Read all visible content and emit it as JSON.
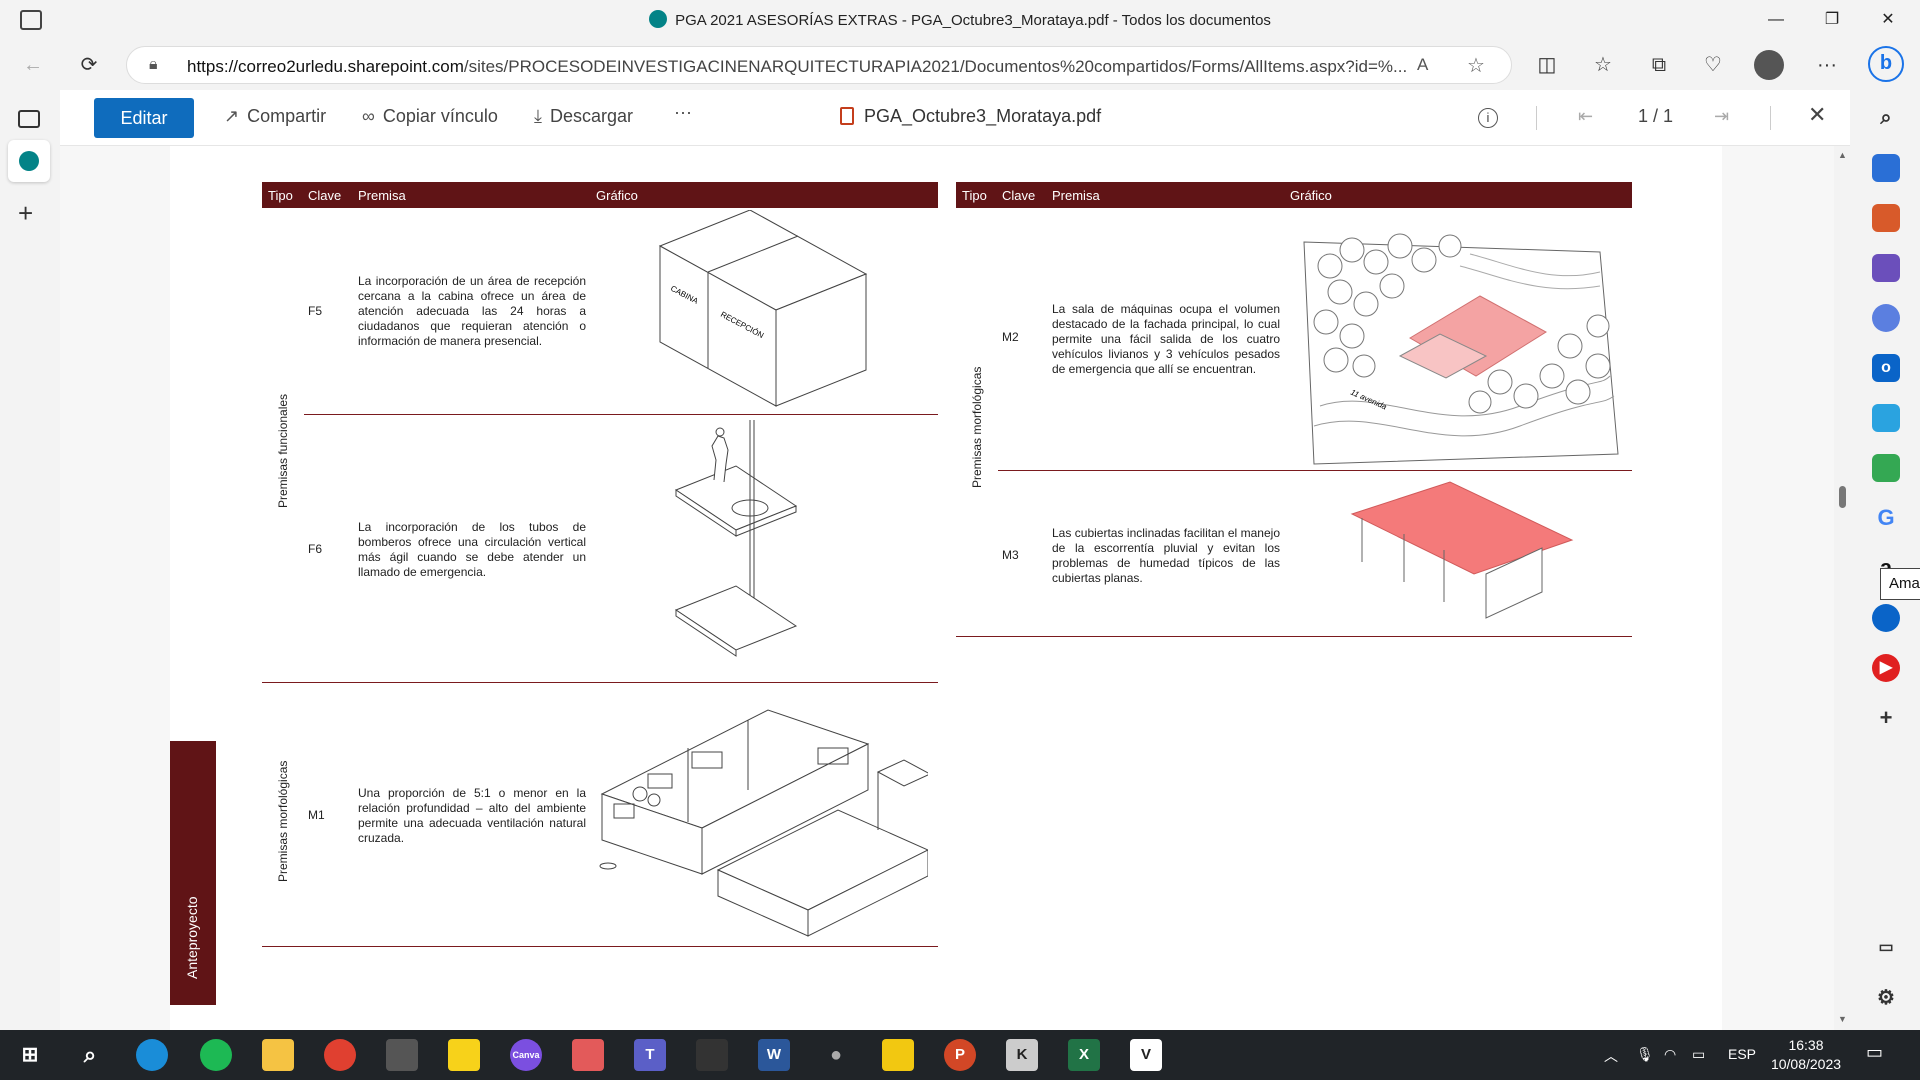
{
  "window": {
    "title": "PGA 2021 ASESORÍAS EXTRAS - PGA_Octubre3_Morataya.pdf - Todos los documentos",
    "minimize_icon": "minimize-icon",
    "maximize_icon": "restore-icon",
    "close_icon": "close-icon"
  },
  "browser": {
    "url_host": "https://correo2urledu.sharepoint.com",
    "url_path": "/sites/PROCESODEINVESTIGACINENARQUITECTURAPIA2021/Documentos%20compartidos/Forms/AllItems.aspx?id=%...",
    "profile_initial": ""
  },
  "viewer": {
    "edit_label": "Editar",
    "share_label": "Compartir",
    "copy_link_label": "Copiar vínculo",
    "download_label": "Descargar",
    "more_label": "···",
    "document_name": "PGA_Octubre3_Morataya.pdf",
    "page_indicator": "1 / 1"
  },
  "document": {
    "headers": {
      "tipo": "Tipo",
      "clave": "Clave",
      "premisa": "Premisa",
      "grafico": "Gráfico"
    },
    "left_rows": [
      {
        "clave": "F5",
        "premisa": "La incorporación de un área de recepción cercana a la cabina ofrece un área de atención adecuada las 24 horas a ciudadanos que requieran atención o información de manera presencial.",
        "labels": [
          "CABINA",
          "RECEPCIÓN"
        ]
      },
      {
        "clave": "F6",
        "premisa": "La incorporación de los tubos de bomberos ofrece una circulación vertical más ágil cuando se debe atender un llamado de emergencia."
      },
      {
        "clave": "M1",
        "premisa": "Una proporción de 5:1 o menor en la relación profundidad – alto del ambiente permite una adecuada ventilación natural cruzada."
      }
    ],
    "left_groups": {
      "funcionales": "Premisas funcionales",
      "morfologicas": "Premisas morfológicas"
    },
    "right_rows": [
      {
        "clave": "M2",
        "premisa": "La sala de máquinas ocupa el volumen destacado de la fachada principal, lo cual permite una fácil salida de los cuatro vehículos livianos y 3 vehículos pesados de emergencia que allí se encuentran.",
        "street_label": "11 avenida"
      },
      {
        "clave": "M3",
        "premisa": "Las cubiertas inclinadas facilitan el manejo de la escorrentía pluvial y evitan los problemas de humedad típicos de las cubiertas planas."
      }
    ],
    "right_group": "Premisas morfológicas",
    "side_tab": "Anteproyecto"
  },
  "tooltip": "Amazon",
  "taskbar": {
    "lang": "ESP",
    "time": "16:38",
    "date": "10/08/2023"
  },
  "colors": {
    "accent": "#0f6cbd",
    "table_header": "#601416",
    "highlight": "#f08a8a"
  }
}
